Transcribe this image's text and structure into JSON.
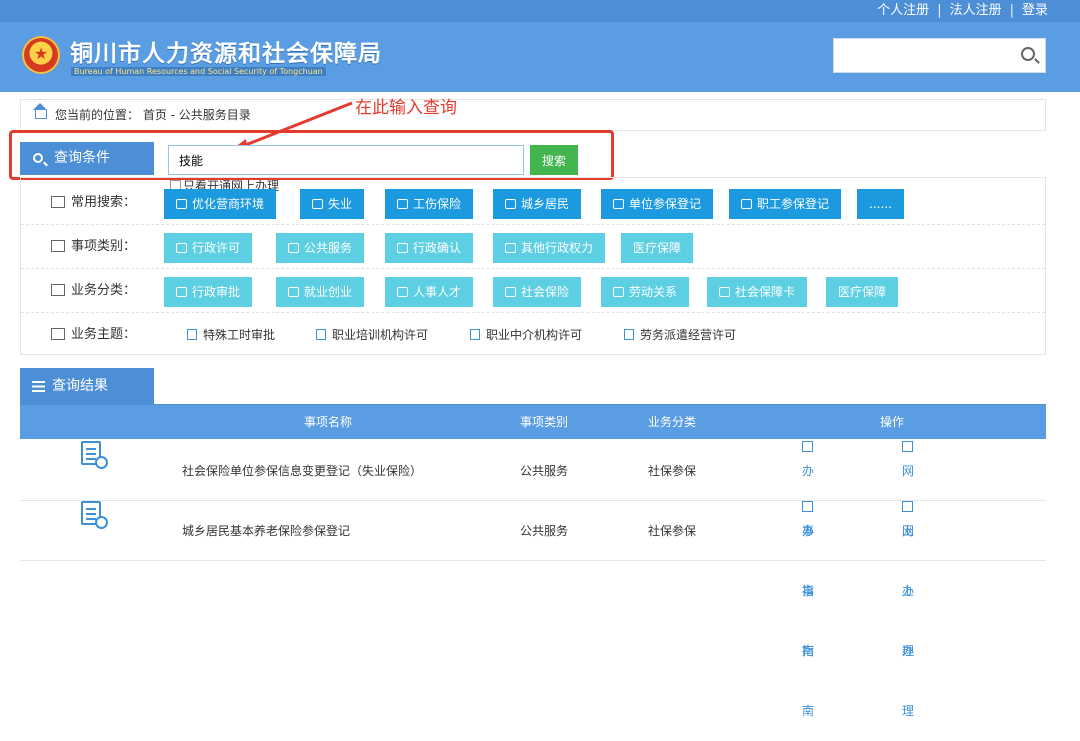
{
  "top_links": {
    "personal_register": "个人注册",
    "separator": "|",
    "legal_register": "法人注册",
    "login": "登录"
  },
  "header": {
    "title": "铜川市人力资源和社会保障局",
    "subtitle": "Bureau of Human Resources and Social Security of Tongchuan",
    "search_placeholder": ""
  },
  "breadcrumb": {
    "text": "您当前的位置： 首页 - 公共服务目录"
  },
  "annotation": {
    "text": "在此输入查询",
    "color": "#e53b2f"
  },
  "query": {
    "label": "查询条件",
    "value": "技能",
    "button": "搜索",
    "online_only": "只看开通网上办理"
  },
  "filters": {
    "common": {
      "label": "常用搜索：",
      "items": [
        "优化营商环境",
        "失业",
        "工伤保险",
        "城乡居民",
        "单位参保登记",
        "职工参保登记",
        "......"
      ]
    },
    "category": {
      "label": "事项类别：",
      "items": [
        "行政许可",
        "公共服务",
        "行政确认",
        "其他行政权力",
        "医疗保障"
      ]
    },
    "business": {
      "label": "业务分类：",
      "items": [
        "行政审批",
        "就业创业",
        "人事人才",
        "社会保险",
        "劳动关系",
        "社会保障卡",
        "医疗保障"
      ]
    },
    "theme": {
      "label": "业务主题：",
      "items": [
        "特殊工时审批",
        "职业培训机构许可",
        "职业中介机构许可",
        "劳务派遣经营许可"
      ]
    }
  },
  "results": {
    "label": "查询结果",
    "headers": {
      "name": "事项名称",
      "category": "事项类别",
      "business": "业务分类",
      "actions": "操作"
    },
    "rows": [
      {
        "name": "社会保险单位参保信息变更登记（失业保险）",
        "category": "公共服务",
        "business": "社保参保",
        "guide": "办事指南",
        "online": "网上办理"
      },
      {
        "name": "城乡居民基本养老保险参保登记",
        "category": "公共服务",
        "business": "社保参保",
        "guide": "办事指南",
        "online": "网上办理"
      }
    ]
  },
  "colors": {
    "primary": "#4d8fd6",
    "header": "#5a9de2",
    "chip_dark": "#1b9ae0",
    "chip_light": "#5dcfe3",
    "search_button": "#43b54e",
    "highlight": "#e53b2f"
  }
}
